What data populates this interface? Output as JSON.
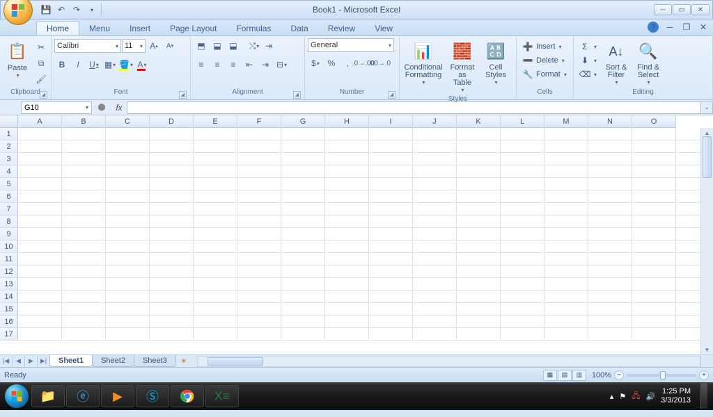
{
  "title": "Book1 - Microsoft Excel",
  "tabs": [
    "Home",
    "Menu",
    "Insert",
    "Page Layout",
    "Formulas",
    "Data",
    "Review",
    "View"
  ],
  "active_tab": "Home",
  "ribbon": {
    "clipboard": {
      "label": "Clipboard",
      "paste": "Paste"
    },
    "font": {
      "label": "Font",
      "name": "Calibri",
      "size": "11"
    },
    "alignment": {
      "label": "Alignment"
    },
    "number": {
      "label": "Number",
      "format": "General"
    },
    "styles": {
      "label": "Styles",
      "cond": "Conditional Formatting",
      "table": "Format as Table",
      "cell": "Cell Styles"
    },
    "cells": {
      "label": "Cells",
      "insert": "Insert",
      "delete": "Delete",
      "format": "Format"
    },
    "editing": {
      "label": "Editing",
      "sort": "Sort & Filter",
      "find": "Find & Select"
    }
  },
  "namebox": "G10",
  "columns": [
    "A",
    "B",
    "C",
    "D",
    "E",
    "F",
    "G",
    "H",
    "I",
    "J",
    "K",
    "L",
    "M",
    "N",
    "O"
  ],
  "rows": [
    1,
    2,
    3,
    4,
    5,
    6,
    7,
    8,
    9,
    10,
    11,
    12,
    13,
    14,
    15,
    16,
    17
  ],
  "sheets": [
    "Sheet1",
    "Sheet2",
    "Sheet3"
  ],
  "active_sheet": "Sheet1",
  "status": "Ready",
  "zoom": "100%",
  "tray": {
    "time": "1:25 PM",
    "date": "3/3/2013"
  }
}
